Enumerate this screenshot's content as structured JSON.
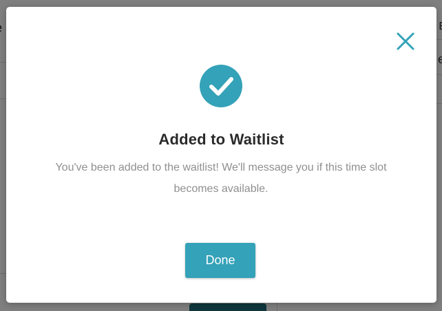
{
  "background": {
    "left_fragment": "e",
    "right_fragment_top": "E",
    "right_fragment_mid": "e"
  },
  "modal": {
    "title": "Added to Waitlist",
    "message": "You've been added to the waitlist! We'll message you if this time slot becomes available.",
    "done_label": "Done",
    "icons": {
      "close": "close-icon",
      "success": "checkmark-circle-icon"
    },
    "colors": {
      "accent": "#34a2b8",
      "title": "#2a2a2a",
      "message": "#8f8f8f"
    }
  }
}
